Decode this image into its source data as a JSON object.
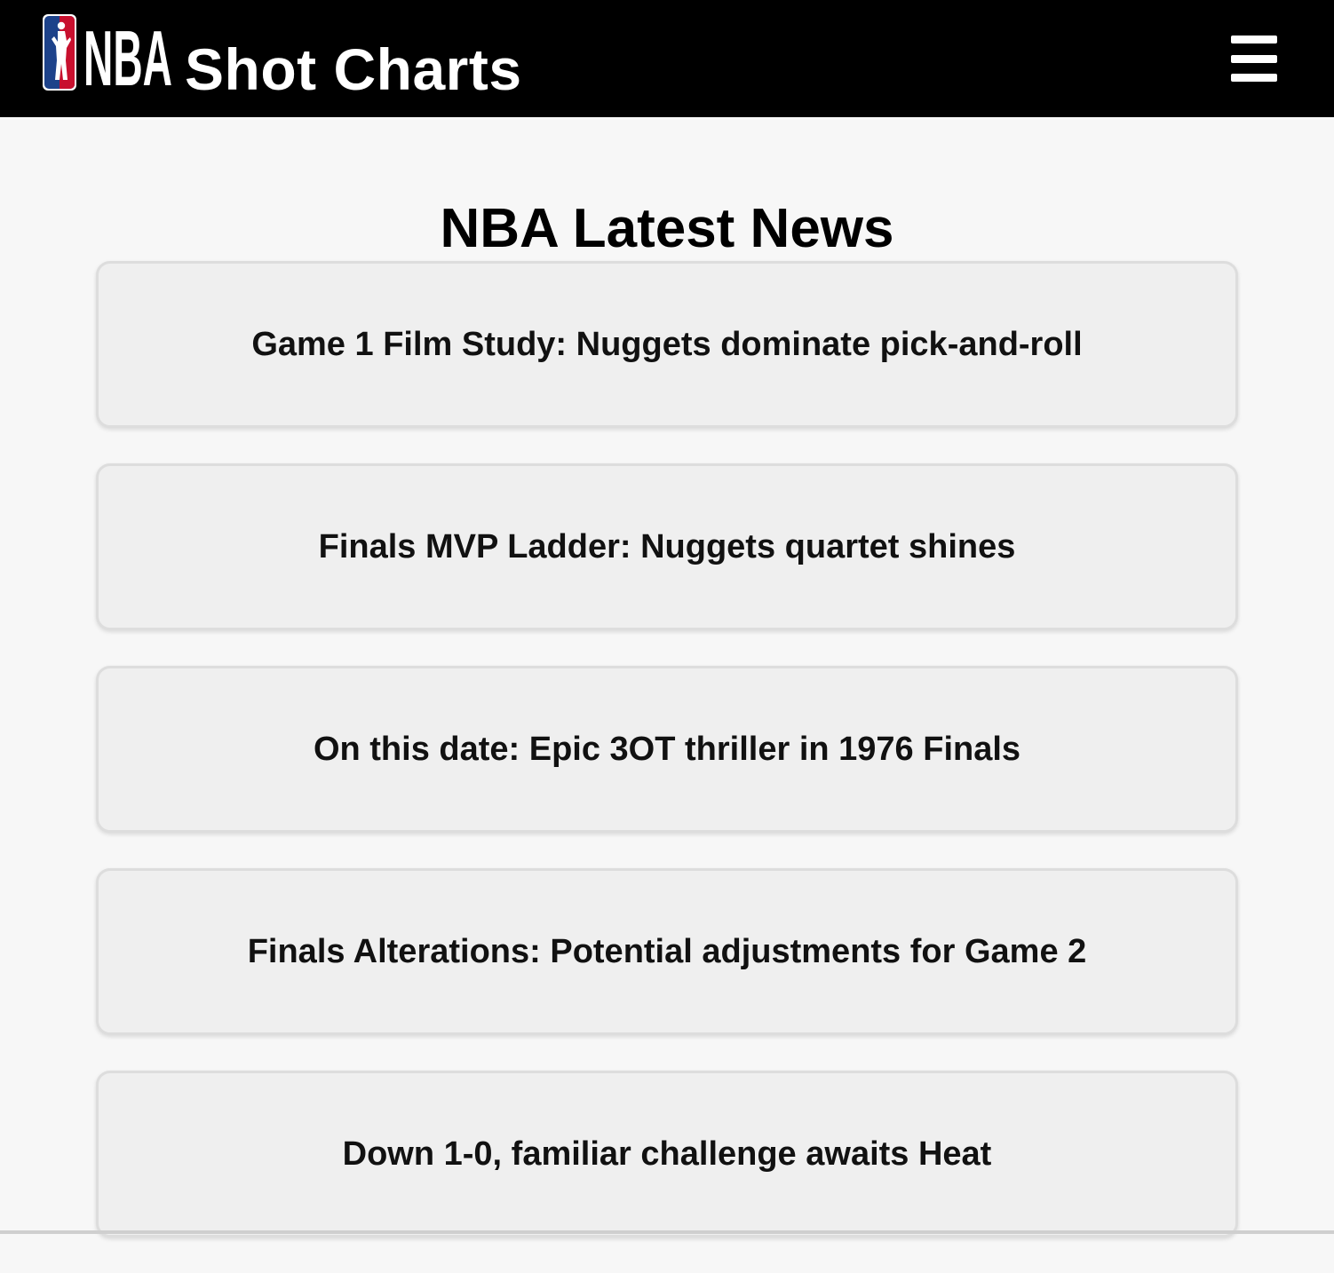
{
  "header": {
    "logo_text": "NBA",
    "title": "Shot Charts",
    "menu_icon": "hamburger-menu-icon",
    "logo_colors": {
      "blue": "#1d428a",
      "red": "#c8102e",
      "white": "#ffffff"
    }
  },
  "main": {
    "heading": "NBA Latest News",
    "news": [
      {
        "title": "Game 1 Film Study: Nuggets dominate pick-and-roll"
      },
      {
        "title": "Finals MVP Ladder: Nuggets quartet shines"
      },
      {
        "title": "On this date: Epic 3OT thriller in 1976 Finals"
      },
      {
        "title": "Finals Alterations: Potential adjustments for Game 2"
      },
      {
        "title": "Down 1-0, familiar challenge awaits Heat"
      }
    ]
  }
}
